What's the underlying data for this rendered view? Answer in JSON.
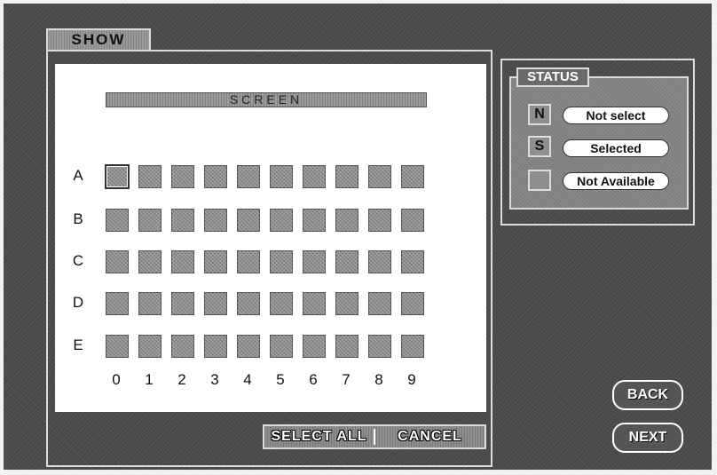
{
  "show_tab": "SHOW",
  "screen_label": "SCREEN",
  "rows": [
    "A",
    "B",
    "C",
    "D",
    "E"
  ],
  "columns": [
    "0",
    "1",
    "2",
    "3",
    "4",
    "5",
    "6",
    "7",
    "8",
    "9"
  ],
  "active_seat": "A0",
  "actions": {
    "select_all": "SELECT ALL",
    "cancel": "CANCEL"
  },
  "status": {
    "title": "STATUS",
    "items": [
      {
        "symbol": "N",
        "label": "Not select"
      },
      {
        "symbol": "S",
        "label": "Selected"
      },
      {
        "symbol": "",
        "label": "Not Available"
      }
    ]
  },
  "nav": {
    "back": "BACK",
    "next": "NEXT"
  }
}
